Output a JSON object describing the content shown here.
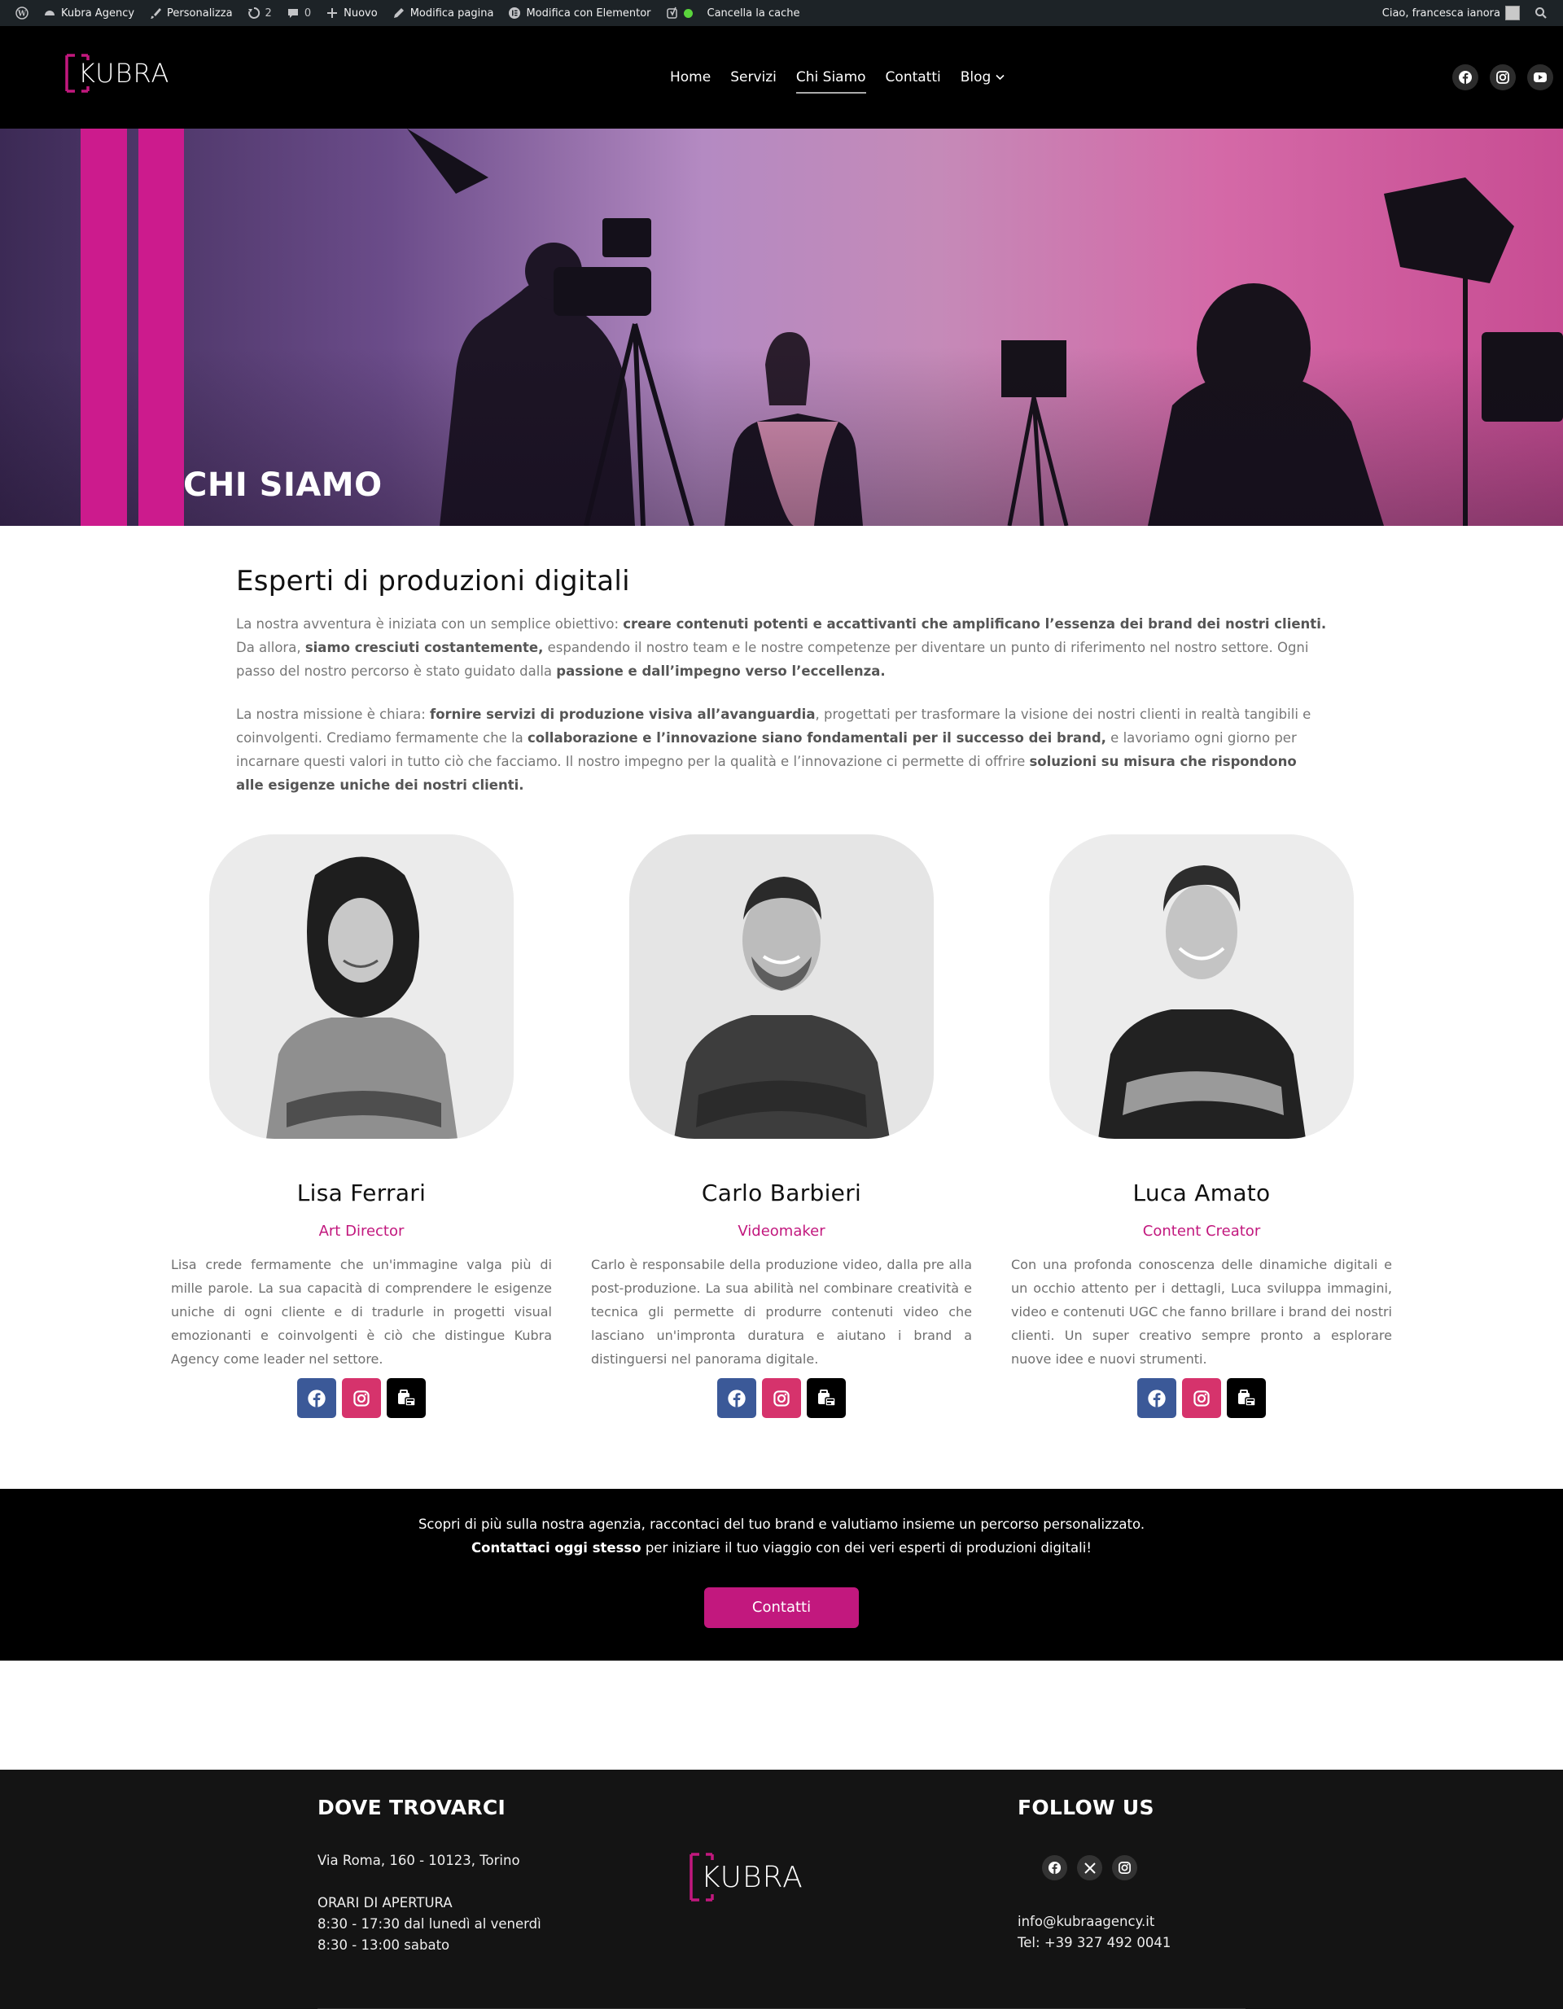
{
  "admin_bar": {
    "site_name": "Kubra Agency",
    "customize": "Personalizza",
    "updates_count": "2",
    "comments_count": "0",
    "new_label": "Nuovo",
    "edit_page": "Modifica pagina",
    "edit_elementor": "Modifica con Elementor",
    "clear_cache": "Cancella la cache",
    "greeting": "Ciao, francesca ianora"
  },
  "header": {
    "logo_text": "KUBRA",
    "nav": [
      "Home",
      "Servizi",
      "Chi Siamo",
      "Contatti",
      "Blog"
    ],
    "active_nav": "Chi Siamo"
  },
  "hero": {
    "title": "CHI SIAMO"
  },
  "about": {
    "heading": "Esperti di produzioni digitali",
    "p1": [
      {
        "t": "La nostra avventura è iniziata con un semplice obiettivo: ",
        "b": false
      },
      {
        "t": "creare contenuti potenti e accattivanti che amplificano l’essenza dei brand dei nostri clienti.",
        "b": true
      },
      {
        "t": " Da allora, ",
        "b": false
      },
      {
        "t": "siamo cresciuti costantemente,",
        "b": true
      },
      {
        "t": " espandendo il nostro team e le nostre competenze per diventare un punto di riferimento nel nostro settore. Ogni passo del nostro percorso è stato guidato dalla ",
        "b": false
      },
      {
        "t": "passione e dall’impegno verso l’eccellenza.",
        "b": true
      }
    ],
    "p2": [
      {
        "t": "La nostra missione è chiara: ",
        "b": false
      },
      {
        "t": "fornire servizi di produzione visiva all’avanguardia",
        "b": true
      },
      {
        "t": ", progettati per trasformare la visione dei nostri clienti in realtà tangibili e coinvolgenti. Crediamo fermamente che la ",
        "b": false
      },
      {
        "t": "collaborazione e l’innovazione siano fondamentali per il successo dei brand,",
        "b": true
      },
      {
        "t": " e lavoriamo ogni giorno per incarnare questi valori in tutto ciò che facciamo. Il nostro impegno per la qualità e l’innovazione ci permette di offrire ",
        "b": false
      },
      {
        "t": "soluzioni su misura che rispondono alle esigenze uniche dei nostri clienti.",
        "b": true
      }
    ]
  },
  "team": [
    {
      "name": "Lisa Ferrari",
      "role": "Art Director",
      "bio": "Lisa crede fermamente che un'immagine valga più di mille parole. La sua capacità di comprendere le esigenze uniche di ogni cliente e di tradurle in progetti visual emozionanti e coinvolgenti è ciò che distingue Kubra Agency come leader nel settore."
    },
    {
      "name": "Carlo Barbieri",
      "role": "Videomaker",
      "bio": "Carlo è responsabile della produzione video, dalla pre alla post-produzione. La sua abilità nel combinare creatività e tecnica gli permette di produrre contenuti video che lasciano un'impronta duratura e aiutano i brand a distinguersi nel panorama digitale."
    },
    {
      "name": "Luca Amato",
      "role": "Content Creator",
      "bio": "Con una profonda conoscenza delle dinamiche digitali e un occhio attento per i dettagli, Luca sviluppa immagini, video e contenuti UGC che fanno brillare i brand dei nostri clienti. Un super creativo sempre pronto a esplorare nuove idee e nuovi strumenti."
    }
  ],
  "cta": {
    "line1": "Scopri di più sulla nostra agenzia, raccontaci del tuo brand e valutiamo insieme un percorso personalizzato.",
    "line2_bold": "Contattaci oggi stesso",
    "line2_rest": " per iniziare il tuo viaggio con dei veri esperti di produzioni digitali!",
    "button": "Contatti"
  },
  "footer": {
    "where_title": "DOVE TROVARCI",
    "address": "Via Roma, 160 - 10123, Torino",
    "hours_title": "ORARI DI APERTURA",
    "hours_weekdays": "8:30 - 17:30 dal lunedì al venerdì",
    "hours_saturday": "8:30 - 13:00 sabato",
    "logo_text": "KUBRA",
    "follow_title": "FOLLOW US",
    "email": "info@kubraagency.it",
    "phone": "Tel: +39 327 492 0041"
  },
  "colors": {
    "accent": "#c2187e",
    "hero_stripe": "#cc1b8d",
    "facebook": "#3b5998",
    "instagram": "#d6336c"
  },
  "icons": [
    "wordpress-icon",
    "dashboard-icon",
    "brush-icon",
    "updates-icon",
    "comment-icon",
    "plus-icon",
    "pencil-icon",
    "elementor-icon",
    "yoast-icon",
    "search-icon",
    "facebook-icon",
    "instagram-icon",
    "youtube-icon",
    "x-icon",
    "portfolio-icon",
    "chevron-down-icon"
  ]
}
